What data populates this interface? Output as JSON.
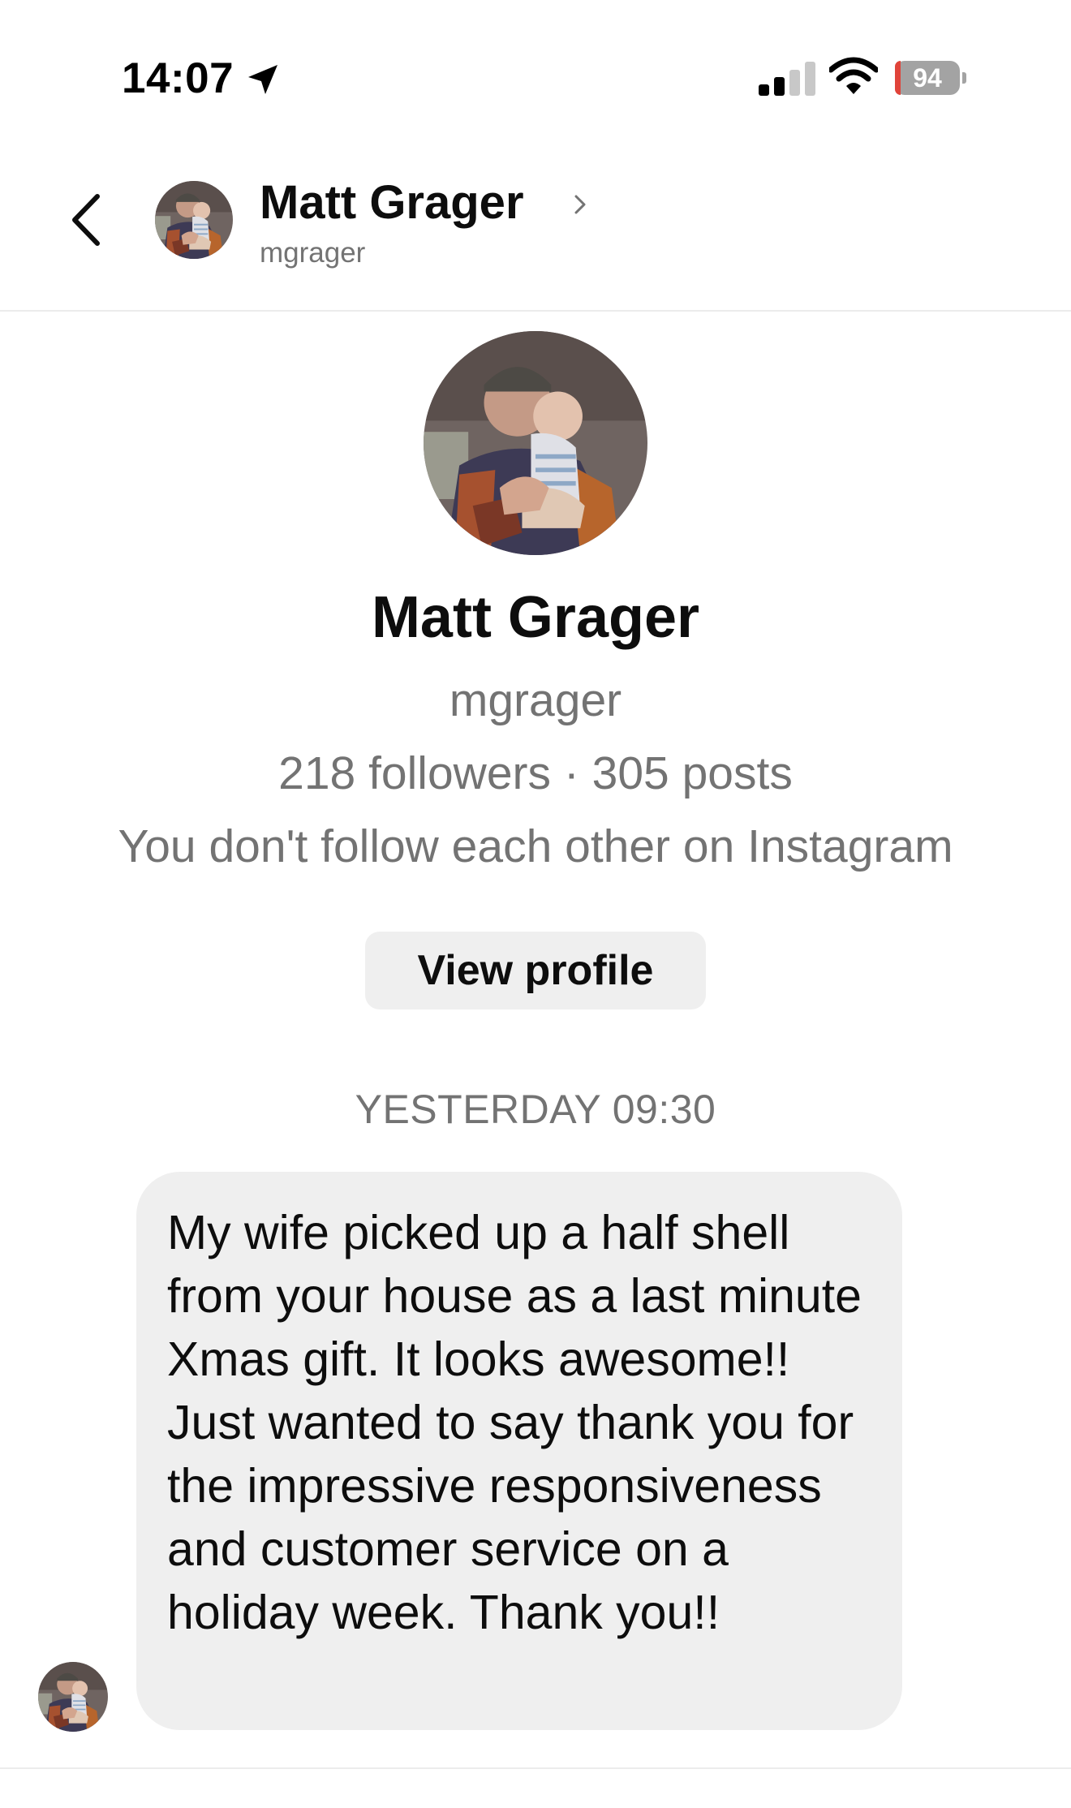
{
  "status_bar": {
    "time": "14:07",
    "battery_level": "94",
    "battery_percent": 9,
    "location_icon": "location-arrow-icon",
    "signal_icon": "cellular-signal-icon",
    "wifi_icon": "wifi-icon"
  },
  "header": {
    "back_icon": "chevron-left-icon",
    "name": "Matt Grager",
    "username": "mgrager",
    "chevron_icon": "chevron-right-icon"
  },
  "profile": {
    "name": "Matt Grager",
    "username": "mgrager",
    "stats": "218 followers · 305 posts",
    "relationship": "You don't follow each other on Instagram",
    "view_profile_label": "View profile"
  },
  "conversation": {
    "timestamp": "YESTERDAY 09:30",
    "messages": [
      {
        "sender": "mgrager",
        "text": "My wife picked up a half shell from your house as a last minute Xmas gift. It looks awesome!! Just wanted to say thank you for the impressive responsiveness and customer service on a holiday week. Thank you!!"
      }
    ]
  },
  "colors": {
    "text_primary": "#0d0d0d",
    "text_secondary": "#737373",
    "bubble_background": "#efefef",
    "battery_low": "#e0443a"
  }
}
